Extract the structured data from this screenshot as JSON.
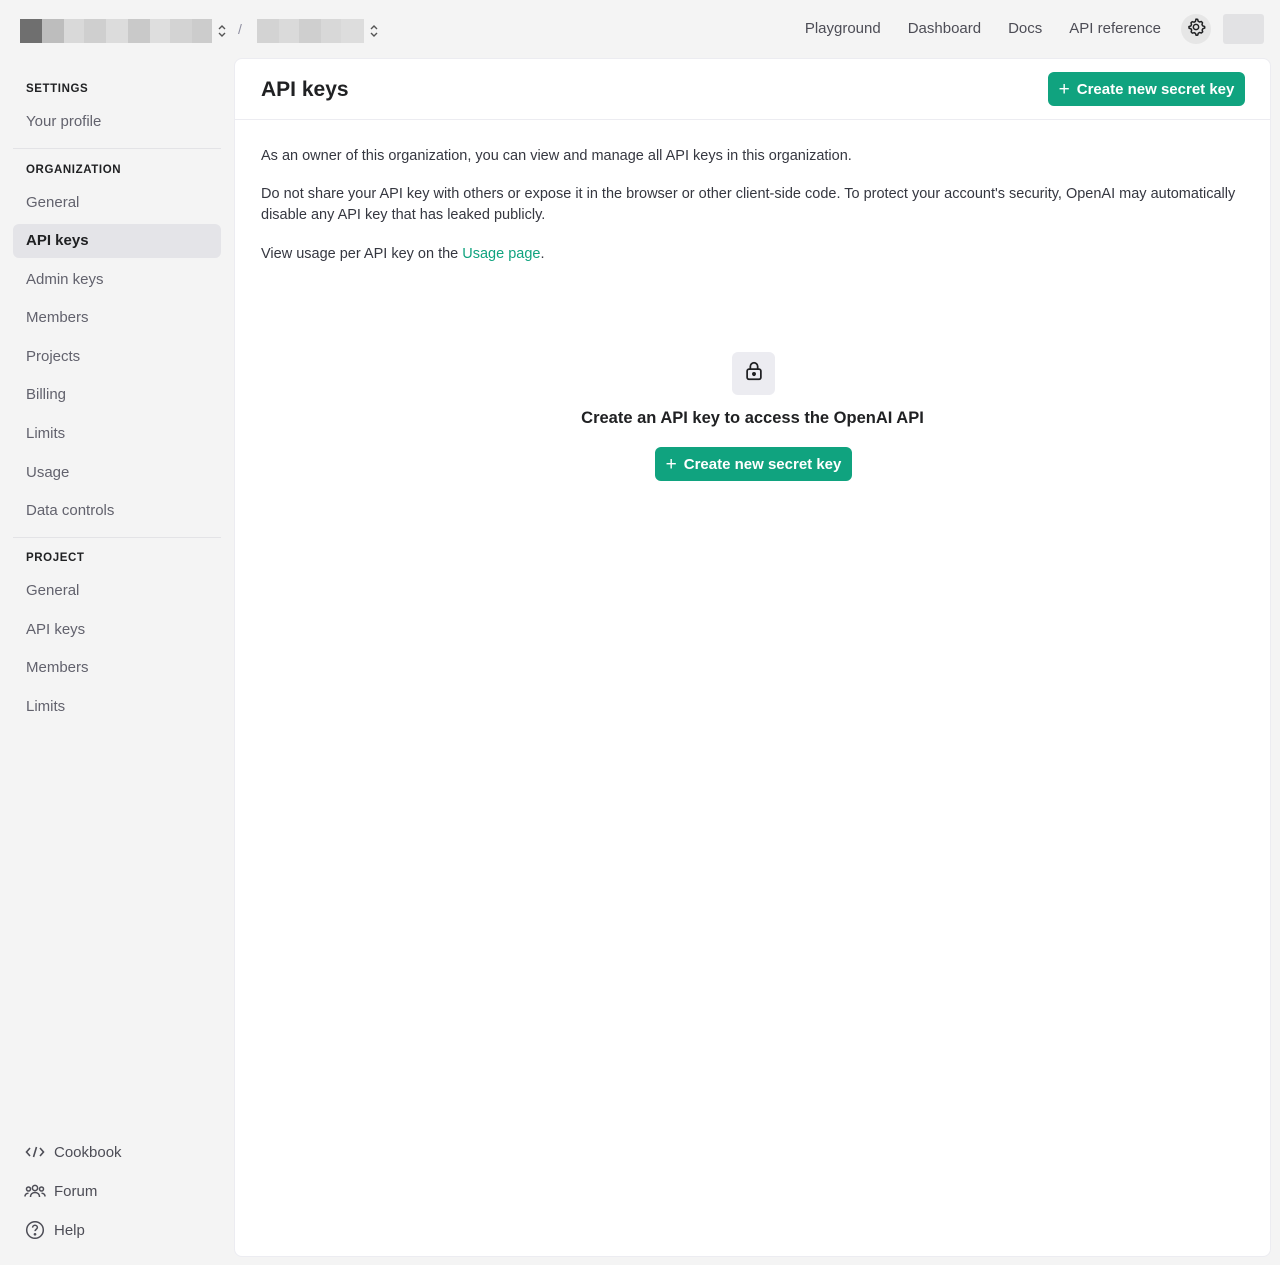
{
  "topbar": {
    "breadcrumb_separator": "/",
    "nav": [
      {
        "label": "Playground"
      },
      {
        "label": "Dashboard"
      },
      {
        "label": "Docs"
      },
      {
        "label": "API reference"
      }
    ],
    "icons": {
      "settings": "gear-icon",
      "org_switch": "chevron-updown-icon",
      "project_switch": "chevron-updown-icon"
    }
  },
  "sidebar": {
    "settings_title": "SETTINGS",
    "your_profile": "Your profile",
    "organization_title": "ORGANIZATION",
    "org_items": [
      "General",
      "API keys",
      "Admin keys",
      "Members",
      "Projects",
      "Billing",
      "Limits",
      "Usage",
      "Data controls"
    ],
    "active_item": "API keys",
    "project_title": "PROJECT",
    "project_items": [
      "General",
      "API keys",
      "Members",
      "Limits"
    ],
    "footer": [
      {
        "label": "Cookbook",
        "icon": "code-icon"
      },
      {
        "label": "Forum",
        "icon": "users-icon"
      },
      {
        "label": "Help",
        "icon": "help-circle-icon"
      }
    ]
  },
  "main": {
    "title": "API keys",
    "create_button_label": "Create new secret key",
    "para1": "As an owner of this organization, you can view and manage all API keys in this organization.",
    "para2": "Do not share your API key with others or expose it in the browser or other client-side code. To protect your account's security, OpenAI may automatically disable any API key that has leaked publicly.",
    "para3_prefix": "View usage per API key on the ",
    "para3_link": "Usage page",
    "para3_suffix": ".",
    "empty_state": {
      "icon": "lock-icon",
      "title": "Create an API key to access the OpenAI API",
      "button_label": "Create new secret key"
    }
  },
  "colors": {
    "accent": "#10a37f",
    "sidebar_bg": "#f4f4f4",
    "active_item_bg": "#e4e4e8"
  }
}
